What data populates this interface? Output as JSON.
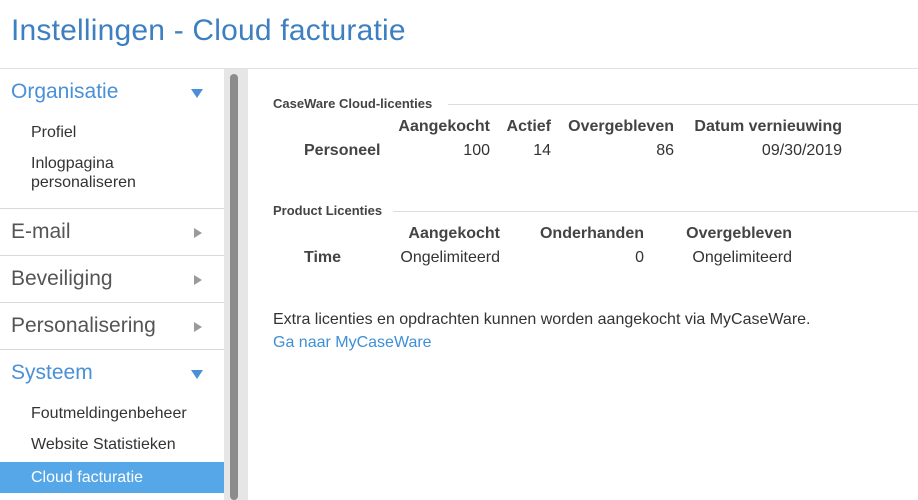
{
  "header": {
    "title": "Instellingen - Cloud facturatie"
  },
  "sidebar": {
    "sections": [
      {
        "label": "Organisatie",
        "expanded": true,
        "items": [
          "Profiel",
          "Inlogpagina personaliseren"
        ]
      },
      {
        "label": "E-mail",
        "expanded": false
      },
      {
        "label": "Beveiliging",
        "expanded": false
      },
      {
        "label": "Personalisering",
        "expanded": false
      },
      {
        "label": "Systeem",
        "expanded": true,
        "items": [
          "Foutmeldingenbeheer",
          "Website Statistieken",
          "Cloud facturatie"
        ]
      }
    ],
    "active_item": "Cloud facturatie"
  },
  "cloud_licenses": {
    "title": "CaseWare Cloud-licenties",
    "columns": [
      "Aangekocht",
      "Actief",
      "Overgebleven",
      "Datum vernieuwing"
    ],
    "rows": [
      {
        "label": "Personeel",
        "values": [
          "100",
          "14",
          "86",
          "09/30/2019"
        ]
      }
    ]
  },
  "product_licenses": {
    "title": "Product Licenties",
    "columns": [
      "Aangekocht",
      "Onderhanden",
      "Overgebleven"
    ],
    "rows": [
      {
        "label": "Time",
        "values": [
          "Ongelimiteerd",
          "0",
          "Ongelimiteerd"
        ]
      }
    ]
  },
  "info": {
    "text": "Extra licenties en opdrachten kunnen worden aangekocht via MyCaseWare.",
    "link": "Ga naar MyCaseWare"
  },
  "colors": {
    "accent": "#4a90d9",
    "active_bg": "#56a7e8",
    "link": "#3d8fd6"
  }
}
